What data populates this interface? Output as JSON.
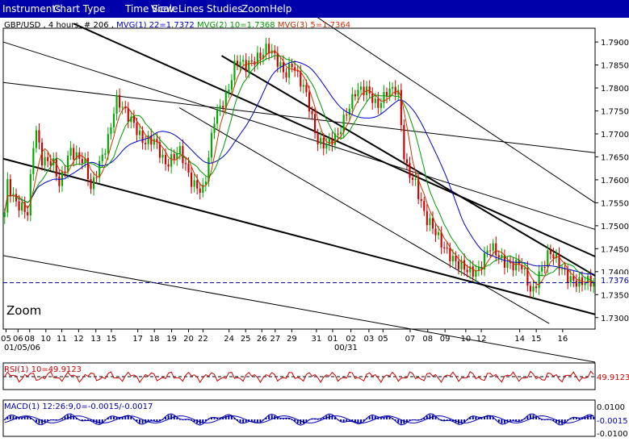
{
  "menu": {
    "items": [
      "Instruments",
      "Chart Type",
      "Time Scale",
      "View",
      "Lines",
      "Studies",
      "Zoom",
      "Help"
    ]
  },
  "main_chart": {
    "header": {
      "prefix": "GBP/USD , 4 hours, # 206 ,",
      "mvg1": "MVG(1) 22=1.7372",
      "mvg2": "MVG(2) 10=1.7368",
      "mvg3": "MVG(3) 5=1.7364"
    },
    "zoom_label": "Zoom",
    "current_price": "1.7376",
    "date_label_left": "01/05/06",
    "date_label_mid": "00/31"
  },
  "rsi_panel": {
    "header": "RSI(1) 10=49.9123",
    "value_label": "49.9123"
  },
  "macd_panel": {
    "header": "MACD(1) 12:26:9,0=-0.0015/-0.0017",
    "labels": [
      "0.0100",
      "-0.0015",
      "-0.0100"
    ]
  },
  "colors": {
    "menu_bg": "#0000aa",
    "up_candle": "#00aa00",
    "down_candle": "#cc0000",
    "mvg1": "#0000cc",
    "mvg2": "#009900",
    "mvg3": "#cc3300",
    "current_price_line": "#0000aa",
    "rsi_line": "#cc0000",
    "macd_line": "#0000aa"
  },
  "chart_data": {
    "type": "candlestick",
    "symbol": "GBP/USD",
    "timeframe": "4 hours",
    "bar_count": 206,
    "y_ticks": [
      1.79,
      1.785,
      1.78,
      1.775,
      1.77,
      1.765,
      1.76,
      1.755,
      1.75,
      1.745,
      1.74,
      1.735,
      1.73
    ],
    "y_tick_labels": [
      "1.7900",
      "1.7850",
      "1.7800",
      "1.7750",
      "1.7700",
      "1.7650",
      "1.7600",
      "1.7550",
      "1.7500",
      "1.7450",
      "1.7400",
      "1.7350",
      "1.7300"
    ],
    "ylim": [
      1.7275,
      1.793
    ],
    "x_tick_labels": [
      "05",
      "06",
      "08",
      "10",
      "11",
      "12",
      "13",
      "15",
      "17",
      "18",
      "19",
      "20",
      "22",
      "24",
      "25",
      "26",
      "27",
      "29",
      "31",
      "01",
      "02",
      "03",
      "05",
      "07",
      "08",
      "09",
      "10",
      "12",
      "14",
      "15",
      "16"
    ],
    "x_tick_positions": [
      0.8,
      4.2,
      7.5,
      12.1,
      16.6,
      21.4,
      26.3,
      30.7,
      38.2,
      42.9,
      47.8,
      52.6,
      56.7,
      64.1,
      68.8,
      73.4,
      77.2,
      81.9,
      88.9,
      93.5,
      98.7,
      103.8,
      107.8,
      115.5,
      120.5,
      125.4,
      131.3,
      135.7,
      146.6,
      151.3,
      158.8
    ],
    "x_range": [
      0,
      168
    ],
    "anchors": [
      [
        0,
        1.748
      ],
      [
        1,
        1.76
      ],
      [
        4,
        1.755
      ],
      [
        7,
        1.752
      ],
      [
        9,
        1.772
      ],
      [
        11,
        1.765
      ],
      [
        14,
        1.764
      ],
      [
        16,
        1.758
      ],
      [
        19,
        1.767
      ],
      [
        23,
        1.764
      ],
      [
        25,
        1.757
      ],
      [
        27,
        1.763
      ],
      [
        30,
        1.77
      ],
      [
        32,
        1.777
      ],
      [
        35,
        1.774
      ],
      [
        37,
        1.773
      ],
      [
        40,
        1.768
      ],
      [
        43,
        1.768
      ],
      [
        46,
        1.764
      ],
      [
        50,
        1.766
      ],
      [
        53,
        1.76
      ],
      [
        57,
        1.758
      ],
      [
        60,
        1.773
      ],
      [
        63,
        1.778
      ],
      [
        66,
        1.786
      ],
      [
        69,
        1.784
      ],
      [
        72,
        1.787
      ],
      [
        75,
        1.789
      ],
      [
        78,
        1.785
      ],
      [
        80,
        1.783
      ],
      [
        82,
        1.786
      ],
      [
        84,
        1.782
      ],
      [
        86,
        1.778
      ],
      [
        89,
        1.769
      ],
      [
        92,
        1.768
      ],
      [
        95,
        1.769
      ],
      [
        98,
        1.776
      ],
      [
        100,
        1.78
      ],
      [
        103,
        1.779
      ],
      [
        106,
        1.776
      ],
      [
        109,
        1.78
      ],
      [
        112,
        1.779
      ],
      [
        114,
        1.763
      ],
      [
        117,
        1.76
      ],
      [
        120,
        1.751
      ],
      [
        123,
        1.748
      ],
      [
        126,
        1.745
      ],
      [
        129,
        1.741
      ],
      [
        132,
        1.74
      ],
      [
        135,
        1.741
      ],
      [
        138,
        1.745
      ],
      [
        141,
        1.743
      ],
      [
        144,
        1.742
      ],
      [
        147,
        1.741
      ],
      [
        150,
        1.735
      ],
      [
        152,
        1.74
      ],
      [
        155,
        1.744
      ],
      [
        158,
        1.741
      ],
      [
        161,
        1.739
      ],
      [
        164,
        1.737
      ],
      [
        167,
        1.7376
      ]
    ],
    "trendlines": [
      [
        0,
        1.7646,
        168,
        1.7307
      ],
      [
        0,
        1.7435,
        168,
        1.7203
      ],
      [
        0,
        1.7812,
        168,
        1.7659
      ],
      [
        20,
        1.794,
        168,
        1.7433
      ],
      [
        62,
        1.787,
        168,
        1.7391
      ],
      [
        0,
        1.79,
        168,
        1.7492
      ],
      [
        50,
        1.7757,
        155,
        1.7287
      ],
      [
        86,
        1.797,
        168,
        1.755
      ]
    ],
    "current_price": 1.7376,
    "rsi": {
      "period": 10,
      "value": 49.9123,
      "range": [
        0,
        100
      ]
    },
    "macd": {
      "fast": 12,
      "slow": 26,
      "signal": 9,
      "value": -0.0015,
      "signal_value": -0.0017,
      "labels": [
        0.01,
        -0.0015,
        -0.01
      ]
    }
  }
}
